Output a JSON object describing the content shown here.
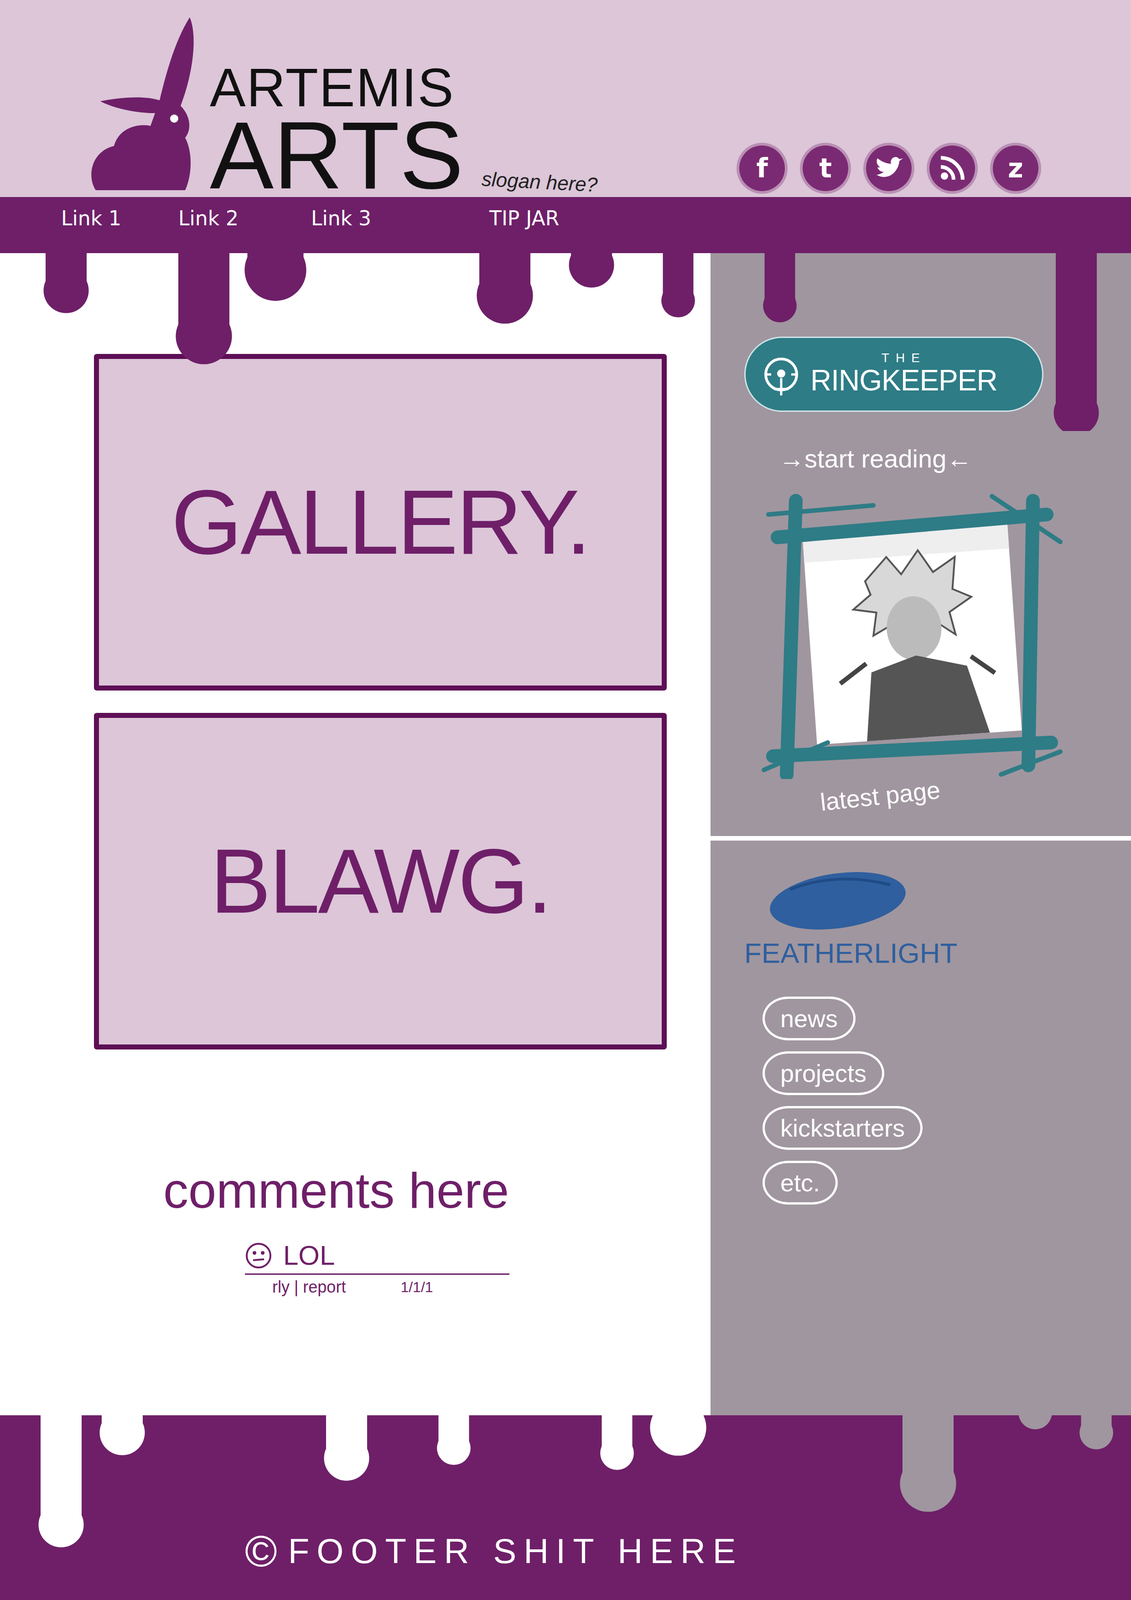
{
  "logo": {
    "line1": "ARTEMIS",
    "line2": "ARTS",
    "slogan": "slogan here?"
  },
  "social": [
    {
      "kind": "letter",
      "label": "f"
    },
    {
      "kind": "letter",
      "label": "t"
    },
    {
      "kind": "bird",
      "label": ""
    },
    {
      "kind": "rss",
      "label": ""
    },
    {
      "kind": "letter",
      "label": "z"
    }
  ],
  "nav": [
    "Link 1",
    "Link 2",
    "Link 3",
    "TIP JAR"
  ],
  "panels": [
    {
      "label": "GALLERY."
    },
    {
      "label": "BLAWG."
    }
  ],
  "comments": {
    "heading": "comments here",
    "items": [
      {
        "text": "LOL",
        "meta": "rly | report",
        "date": "1/1/1"
      }
    ]
  },
  "sidebar": {
    "comic": {
      "logo_small": "THE",
      "logo": "RINGKEEPER",
      "start": "→start reading←",
      "latest": "latest page"
    },
    "studio": {
      "logo": "FEATHERLIGHT",
      "links": [
        "news",
        "projects",
        "kickstarters",
        "etc."
      ]
    }
  },
  "footer": {
    "symbol": "©",
    "text": "FOOTER SHIT HERE"
  }
}
